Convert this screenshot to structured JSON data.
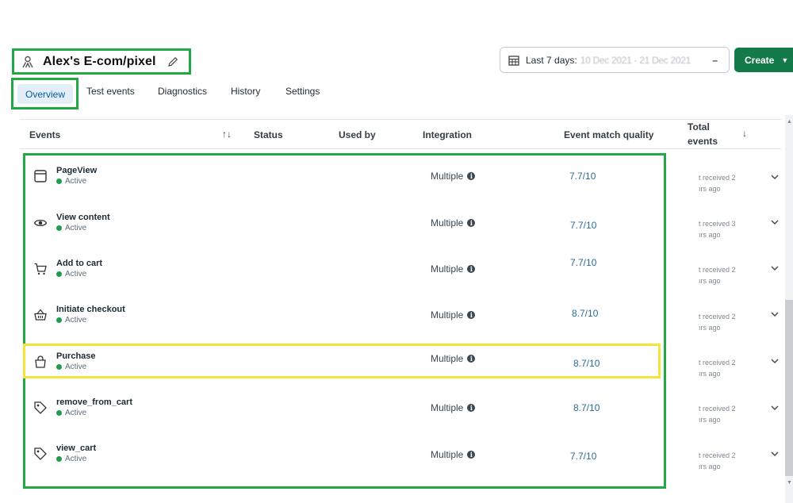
{
  "header": {
    "title": "Alex's E-com/pixel",
    "date_label": "Last 7 days:",
    "date_range": "10 Dec 2021 - 21 Dec 2021",
    "date_clear": "–",
    "create_label": "Create",
    "create_caret": "▼"
  },
  "tabs": [
    {
      "label": "Overview"
    },
    {
      "label": "Test events"
    },
    {
      "label": "Diagnostics"
    },
    {
      "label": "History"
    },
    {
      "label": "Settings"
    }
  ],
  "table": {
    "columns": {
      "events": "Events",
      "sort": "↑↓",
      "status": "Status",
      "used_by": "Used by",
      "integration": "Integration",
      "emq": "Event match quality",
      "total_line1": "Total",
      "total_line2": "events",
      "total_sort": "↓"
    },
    "rows": [
      {
        "name": "PageView",
        "status": "Active",
        "integration": "Multiple",
        "emq": "7.7/10",
        "rec1": "t received 2",
        "rec2": "ırs ago",
        "icon": "page-icon"
      },
      {
        "name": "View content",
        "status": "Active",
        "integration": "Multiple",
        "emq": "7.7/10",
        "rec1": "t received 3",
        "rec2": "ırs ago",
        "icon": "eye-icon"
      },
      {
        "name": "Add to cart",
        "status": "Active",
        "integration": "Multiple",
        "emq": "7.7/10",
        "rec1": "t received 2",
        "rec2": "ırs ago",
        "icon": "cart-icon"
      },
      {
        "name": "Initiate checkout",
        "status": "Active",
        "integration": "Multiple",
        "emq": "8.7/10",
        "rec1": "t received 2",
        "rec2": "ırs ago",
        "icon": "basket-icon"
      },
      {
        "name": "Purchase",
        "status": "Active",
        "integration": "Multiple",
        "emq": "8.7/10",
        "rec1": "t received 2",
        "rec2": "ırs ago",
        "icon": "bag-icon"
      },
      {
        "name": "remove_from_cart",
        "status": "Active",
        "integration": "Multiple",
        "emq": "8.7/10",
        "rec1": "t received 2",
        "rec2": "ırs ago",
        "icon": "tag-icon"
      },
      {
        "name": "view_cart",
        "status": "Active",
        "integration": "Multiple",
        "emq": "7.7/10",
        "rec1": "t received 2",
        "rec2": "ırs ago",
        "icon": "tag-icon"
      }
    ]
  },
  "colors": {
    "annotation_green": "#22a844",
    "annotation_yellow": "#f5e53a",
    "create_button": "#147a4a",
    "active_dot": "#1f9d4a",
    "emq_text": "#2a6c9a"
  }
}
